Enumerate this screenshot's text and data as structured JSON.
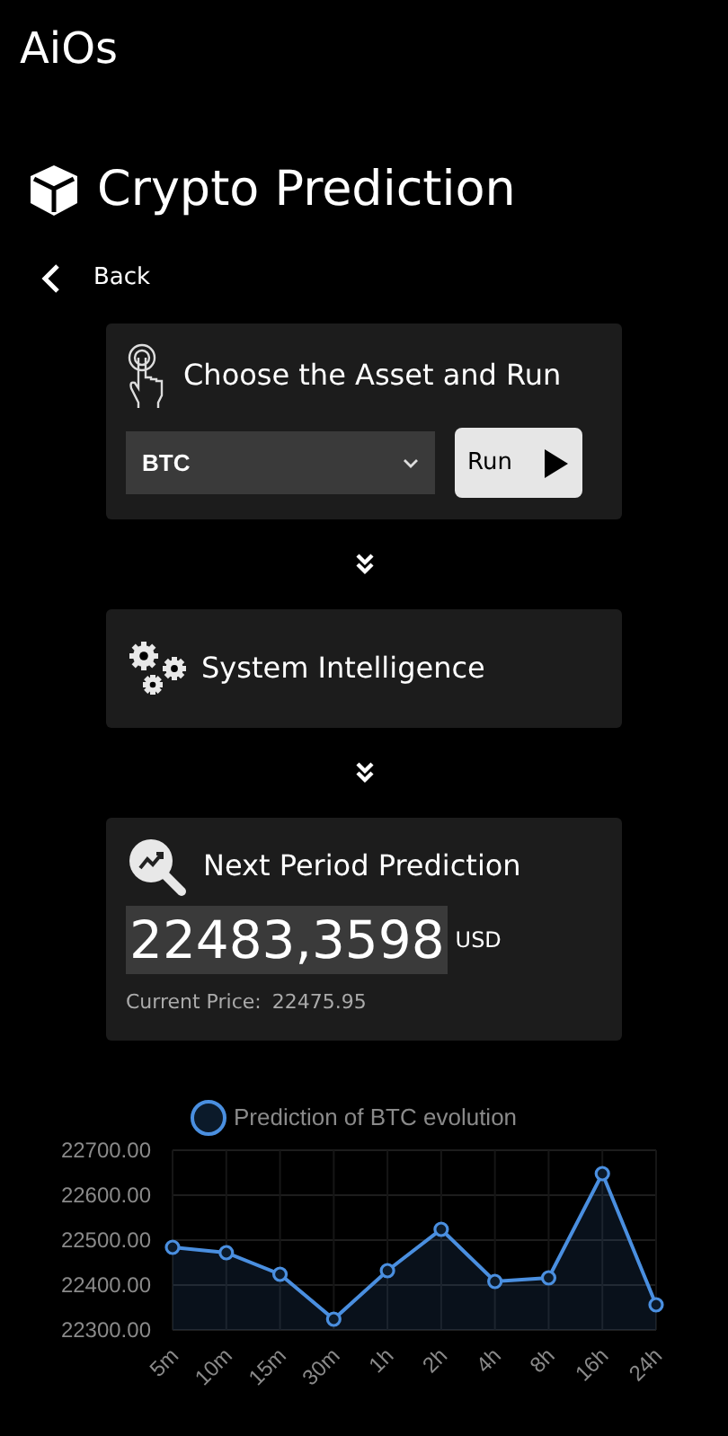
{
  "app_title": "AiOs",
  "page_title": "Crypto Prediction",
  "back": {
    "label": "Back"
  },
  "steps": [
    {
      "kind": "input",
      "title": "Choose the Asset and Run",
      "asset": "BTC",
      "button": "Run"
    },
    {
      "kind": "process",
      "title": "System Intelligence"
    },
    {
      "kind": "result",
      "title": "Next Period Prediction",
      "value": "22483,3598",
      "unit": "USD",
      "current_label": "Current Price:",
      "current_value": "22475.95"
    }
  ],
  "chart_data": {
    "type": "area",
    "categories": [
      "5m",
      "10m",
      "15m",
      "30m",
      "1h",
      "2h",
      "4h",
      "8h",
      "16h",
      "24h"
    ],
    "series": [
      {
        "name": "Prediction of BTC evolution",
        "color": "#4a8fe0",
        "values": [
          22484,
          22472,
          22424,
          22324,
          22432,
          22524,
          22408,
          22416,
          22648,
          22356
        ]
      }
    ],
    "ylim": [
      22300,
      22700
    ],
    "grid": true,
    "yticks": [
      {
        "value": 22300,
        "label": "22300.00"
      },
      {
        "value": 22400,
        "label": "22400.00"
      },
      {
        "value": 22500,
        "label": "22500.00"
      },
      {
        "value": 22600,
        "label": "22600.00"
      },
      {
        "value": 22700,
        "label": "22700.00"
      }
    ]
  }
}
